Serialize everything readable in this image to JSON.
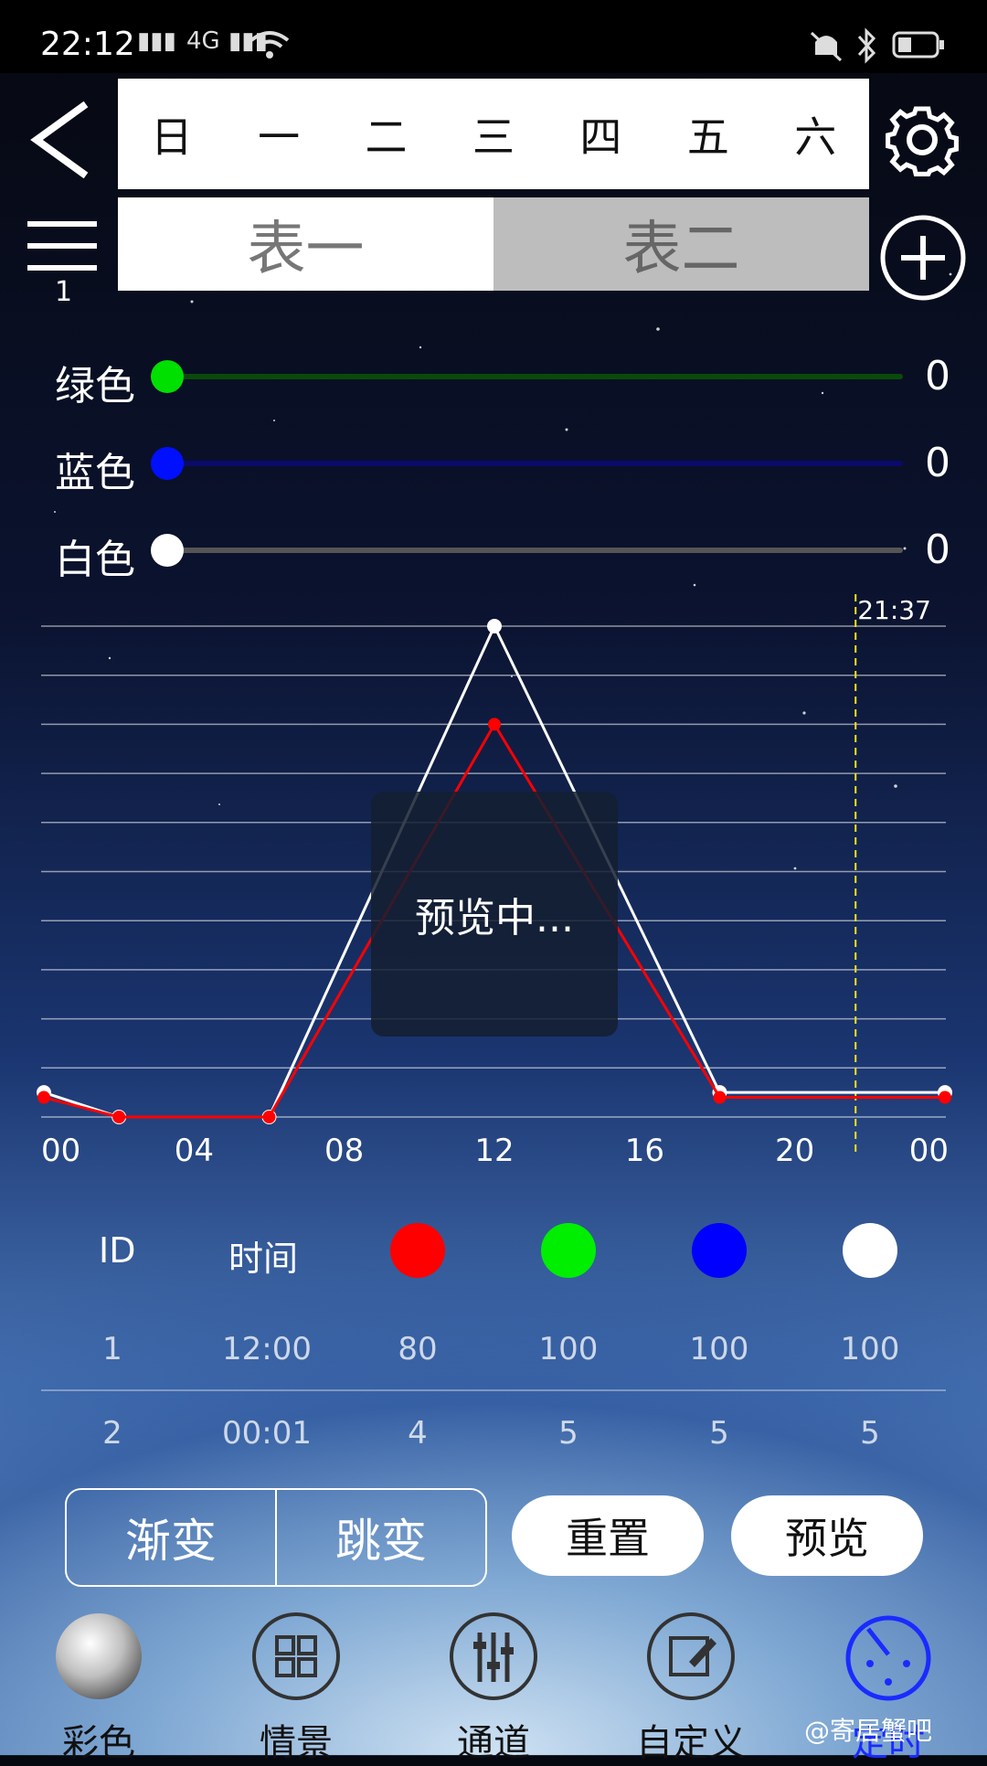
{
  "status_bar": {
    "time": "22:12",
    "network": "4G"
  },
  "header": {
    "days": [
      "日",
      "一",
      "二",
      "三",
      "四",
      "五",
      "六"
    ],
    "tabs": [
      "表一",
      "表二"
    ],
    "menu_badge": "1"
  },
  "sliders": [
    {
      "label": "绿色",
      "value": "0",
      "color": "#00e000",
      "track": "#0a4a0a"
    },
    {
      "label": "蓝色",
      "value": "0",
      "color": "#0010ff",
      "track": "#0a0a6a"
    },
    {
      "label": "白色",
      "value": "0",
      "color": "#ffffff",
      "track": "#555555"
    }
  ],
  "chart": {
    "now_marker": "21:37",
    "x_labels": [
      "00",
      "04",
      "08",
      "12",
      "16",
      "20",
      "00"
    ],
    "toast": "预览中..."
  },
  "chart_data": {
    "type": "line",
    "x_unit": "hour",
    "xlim": [
      0,
      24
    ],
    "ylim": [
      0,
      100
    ],
    "now_hour": 21.62,
    "series": [
      {
        "color": "#ffffff",
        "points": [
          [
            0,
            5
          ],
          [
            2,
            0
          ],
          [
            6,
            0
          ],
          [
            12,
            100
          ],
          [
            18,
            5
          ],
          [
            24,
            5
          ]
        ]
      },
      {
        "color": "#ff0000",
        "points": [
          [
            0,
            4
          ],
          [
            2,
            0
          ],
          [
            6,
            0
          ],
          [
            12,
            80
          ],
          [
            18,
            4
          ],
          [
            24,
            4
          ]
        ]
      }
    ]
  },
  "table": {
    "headers": {
      "id": "ID",
      "time": "时间"
    },
    "dot_colors": [
      "#ff0000",
      "#00ee00",
      "#0000ff",
      "#ffffff"
    ],
    "rows": [
      {
        "id": "1",
        "time": "12:00",
        "r": "80",
        "g": "100",
        "b": "100",
        "w": "100"
      },
      {
        "id": "2",
        "time": "00:01",
        "r": "4",
        "g": "5",
        "b": "5",
        "w": "5"
      }
    ]
  },
  "buttons": {
    "gradual": "渐变",
    "jump": "跳变",
    "reset": "重置",
    "preview": "预览"
  },
  "nav": [
    "彩色",
    "情景",
    "通道",
    "自定义",
    "定时"
  ],
  "watermark": "@寄居蟹吧"
}
